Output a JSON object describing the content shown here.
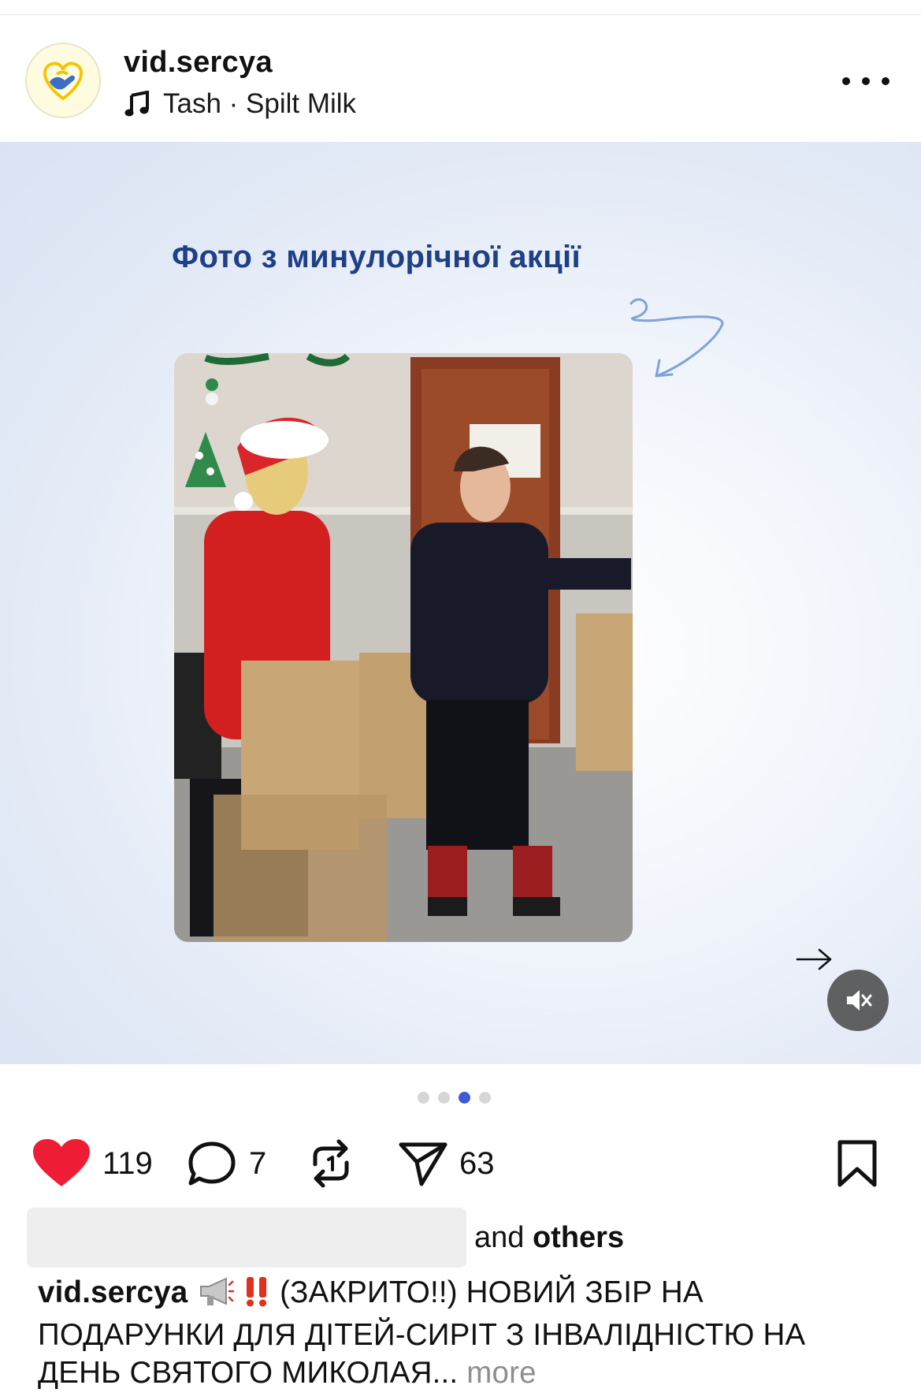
{
  "post": {
    "username": "vid.sercya",
    "music": "Tash · Spilt Milk",
    "more_icon": "more-horizontal-icon"
  },
  "slide": {
    "title": "Фото з минулорічної акції",
    "current_index": 3,
    "total": 4
  },
  "actions": {
    "likes": "119",
    "comments": "7",
    "shares": "63"
  },
  "likes_summary": {
    "and_text": "and",
    "others_text": "others"
  },
  "caption": {
    "username": "vid.sercya",
    "text": "(ЗАКРИТО!!) НОВИЙ ЗБІР НА ПОДАРУНКИ ДЛЯ ДІТЕЙ-СИРІТ З ІНВАЛІДНІСТЮ НА ДЕНЬ СВЯТОГО МИКОЛАЯ...",
    "more": "more"
  },
  "colors": {
    "heart": "#ee1d35",
    "title_blue": "#1f3f86",
    "active_dot": "#3d5ad9"
  }
}
